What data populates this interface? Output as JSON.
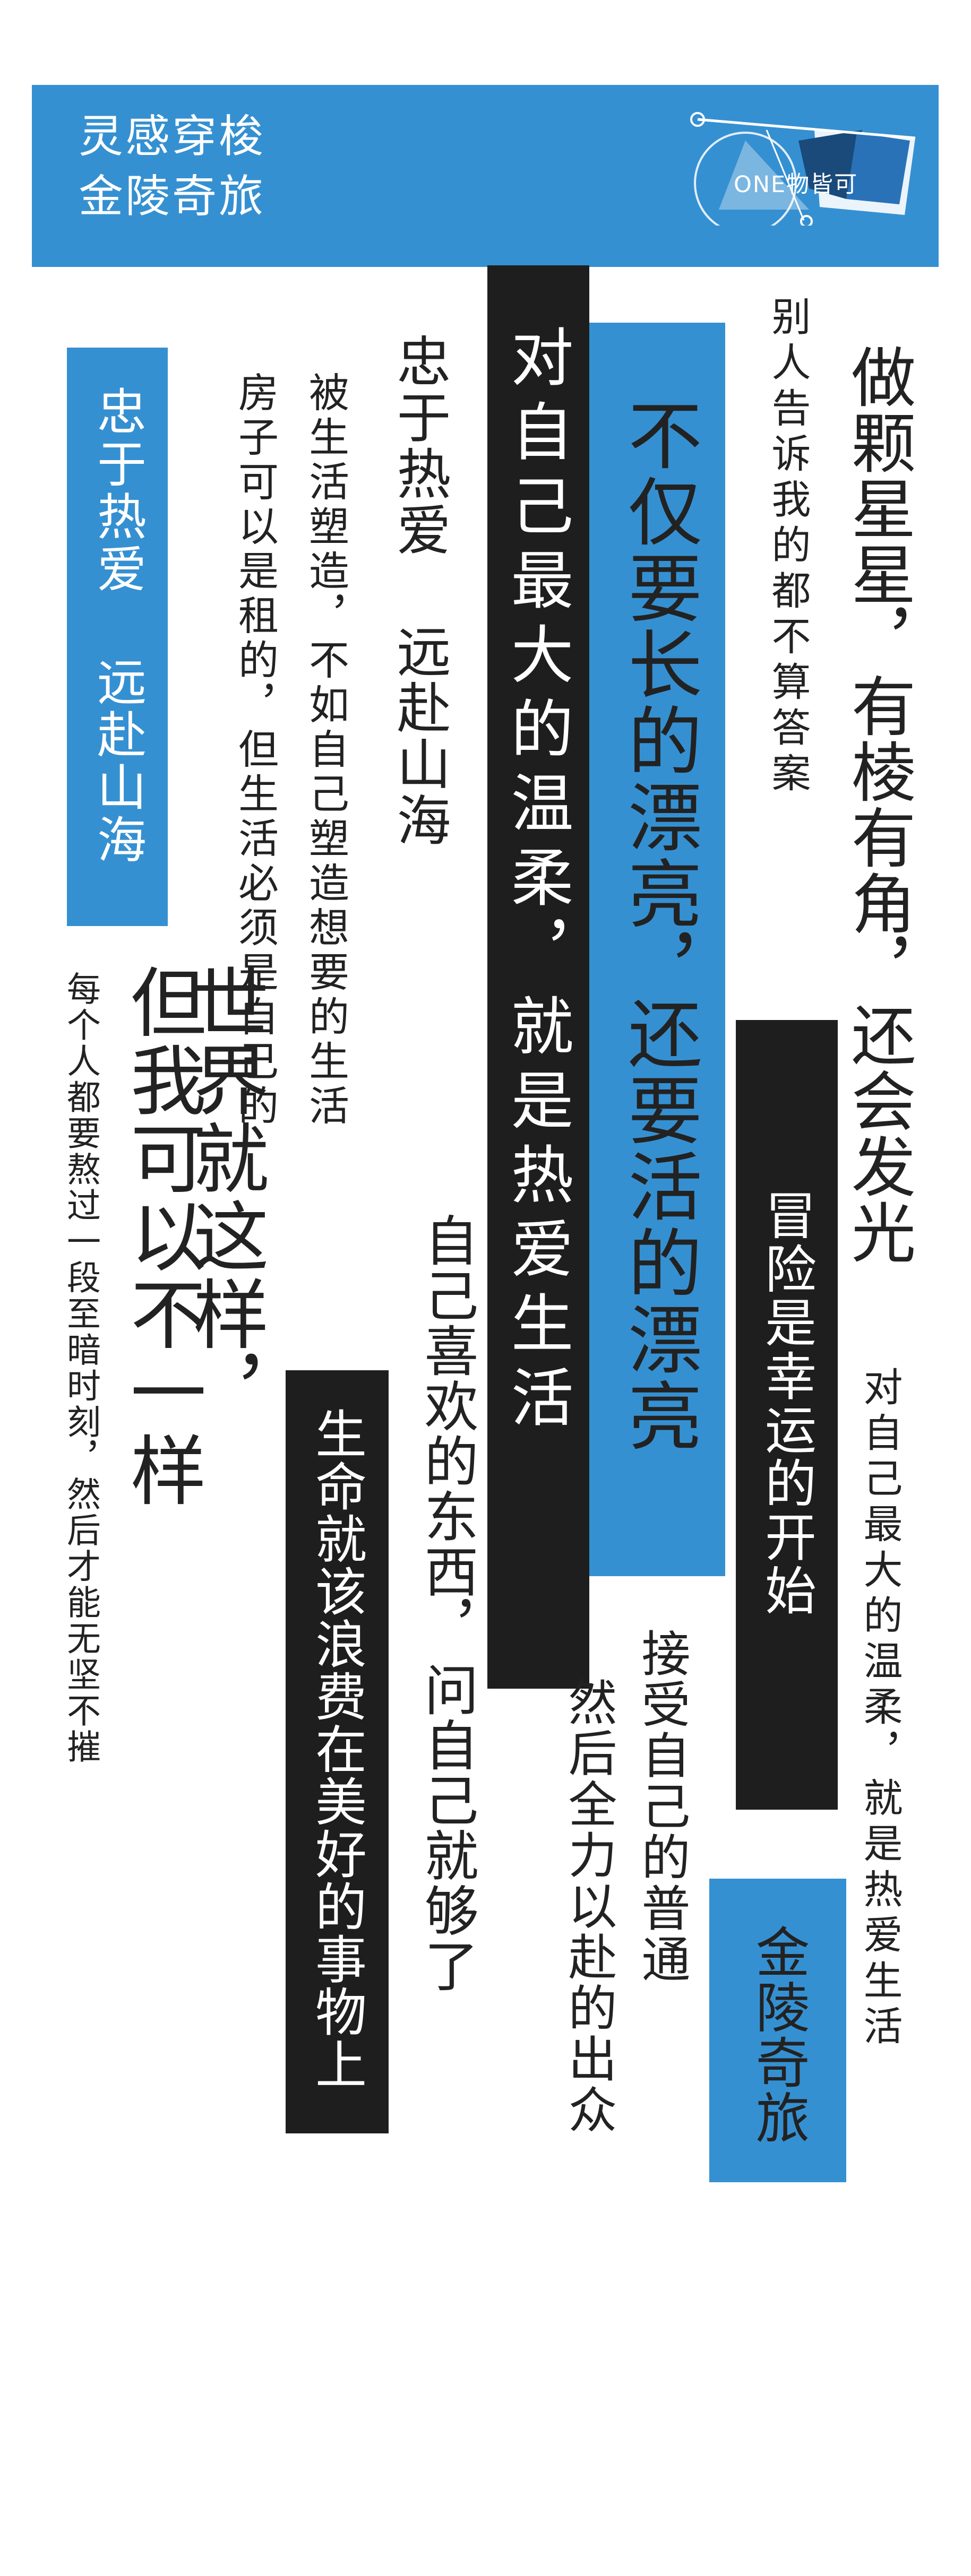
{
  "header": {
    "title_line1": "灵感穿梭",
    "title_line2": "金陵奇旅",
    "logo": {
      "text": "ONE物皆可",
      "icon": "origami-boat-logo",
      "colors": [
        "#ffffff",
        "#1a4a7a",
        "#2a72b8",
        "#ffffff"
      ]
    }
  },
  "colors": {
    "blue": "#3590d2",
    "dark": "#1e1e1e",
    "ink": "#222222",
    "background": "#ffffff"
  },
  "phrases": {
    "col_blue_left": "忠于热爱 远赴山海",
    "col_every": "每个人都要熬过一段至暗时刻，然后才能无坚不摧",
    "col_world_a": "世界就这样，",
    "col_world_b": "但我可以不一样",
    "col_shaped_a": "被生活塑造，不如自己塑造想要的生活",
    "col_shaped_b": "房子可以是租的，但生活必须是自己的",
    "col_loyal": "忠于热爱 远赴山海",
    "col_waste": "生命就该浪费在美好的事物上",
    "col_dark_tall": "对自己最大的温柔，就是热爱生活",
    "col_like_a": "自己喜欢的东西，",
    "col_like_b": "问自己就够了",
    "col_blue_tall_a": "不仅要长的漂亮，",
    "col_blue_tall_b": "还要活的漂亮",
    "col_accept_a": "接受自己的普通",
    "col_accept_b": "然后全力以赴的出众",
    "col_others": "别人告诉我的都不算答案",
    "col_risk": "冒险是幸运的开始",
    "col_star_a": "做颗星星，有棱有角，",
    "col_star_b": "还会发光",
    "col_gentle": "对自己最大的温柔，就是热爱生活",
    "col_jinling": "金陵奇旅"
  }
}
